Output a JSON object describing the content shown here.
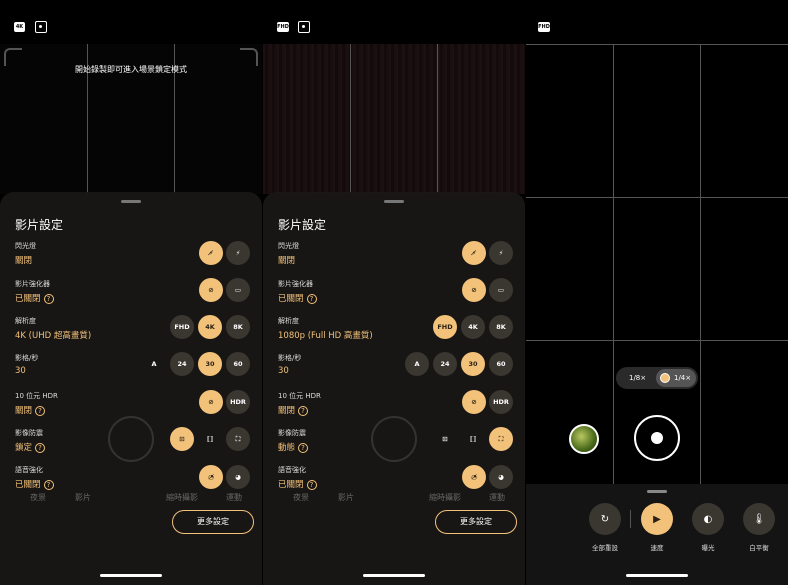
{
  "screen1": {
    "top_badge": "4K",
    "hint": "開始錄製即可進入場景鎖定模式",
    "sheet_title": "影片設定",
    "rows": [
      {
        "label": "閃光燈",
        "value": "關閉",
        "help": ""
      },
      {
        "label": "影片強化器",
        "value": "已關閉",
        "help": "?"
      },
      {
        "label": "解析度",
        "value": "4K (UHD 超高畫質)",
        "help": ""
      },
      {
        "label": "影格/秒",
        "value": "30",
        "help": ""
      },
      {
        "label": "10 位元 HDR",
        "value": "關閉",
        "help": "?"
      },
      {
        "label": "影像防震",
        "value": "鎖定",
        "help": "?"
      },
      {
        "label": "語音強化",
        "value": "已關閉",
        "help": "?"
      }
    ],
    "resolution_options": [
      "FHD",
      "4K",
      "8K"
    ],
    "fps_options": [
      "A",
      "24",
      "30",
      "60"
    ],
    "hdr_option": "HDR",
    "more_button": "更多設定",
    "ghost_modes": [
      "夜景",
      "影片",
      "縮時攝影",
      "運動"
    ]
  },
  "screen2": {
    "top_badge": "FHD",
    "sheet_title": "影片設定",
    "rows": [
      {
        "label": "閃光燈",
        "value": "關閉",
        "help": ""
      },
      {
        "label": "影片強化器",
        "value": "已關閉",
        "help": "?"
      },
      {
        "label": "解析度",
        "value": "1080p (Full HD 高畫質)",
        "help": ""
      },
      {
        "label": "影格/秒",
        "value": "30",
        "help": ""
      },
      {
        "label": "10 位元 HDR",
        "value": "關閉",
        "help": "?"
      },
      {
        "label": "影像防震",
        "value": "動態",
        "help": "?"
      },
      {
        "label": "語音強化",
        "value": "已關閉",
        "help": "?"
      }
    ],
    "resolution_options": [
      "FHD",
      "4K",
      "8K"
    ],
    "fps_options": [
      "A",
      "24",
      "30",
      "60"
    ],
    "hdr_option": "HDR",
    "more_button": "更多設定",
    "ghost_modes": [
      "夜景",
      "影片",
      "縮時攝影",
      "運動"
    ]
  },
  "screen3": {
    "top_badge": "FHD",
    "speed_options": [
      "1/8×",
      "1/4×"
    ],
    "speed_selected": "1/4×",
    "tools": [
      {
        "label": "全部重設",
        "icon": "reset-icon"
      },
      {
        "label": "速度",
        "icon": "speed-icon"
      },
      {
        "label": "曝光",
        "icon": "exposure-icon"
      },
      {
        "label": "白平衡",
        "icon": "white-balance-icon"
      }
    ]
  },
  "colors": {
    "accent": "#f3c27a",
    "sheet": "#1a1815",
    "chip": "#3a3630"
  }
}
